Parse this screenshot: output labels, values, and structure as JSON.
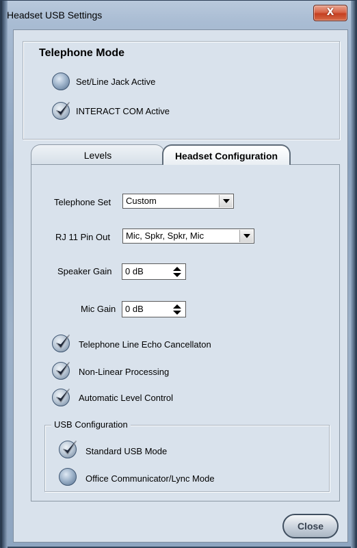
{
  "window": {
    "title": "Headset USB Settings",
    "close_glyph": "X"
  },
  "telephone_mode": {
    "title": "Telephone Mode",
    "options": [
      {
        "label": "Set/Line Jack Active",
        "selected": false
      },
      {
        "label": "INTERACT COM  Active",
        "selected": true
      }
    ]
  },
  "tabs": [
    {
      "label": "Levels",
      "active": false
    },
    {
      "label": "Headset Configuration",
      "active": true
    }
  ],
  "config": {
    "telephone_set": {
      "label": "Telephone Set",
      "value": "Custom"
    },
    "rj11_pin_out": {
      "label": "RJ 11 Pin Out",
      "value": "Mic, Spkr, Spkr, Mic"
    },
    "speaker_gain": {
      "label": "Speaker Gain",
      "value": "0 dB"
    },
    "mic_gain": {
      "label": "Mic Gain",
      "value": "0 dB"
    },
    "checks": [
      {
        "label": "Telephone Line Echo Cancellaton",
        "checked": true
      },
      {
        "label": "Non-Linear Processing",
        "checked": true
      },
      {
        "label": "Automatic Level Control",
        "checked": true
      }
    ]
  },
  "usb": {
    "title": "USB Configuration",
    "options": [
      {
        "label": "Standard USB Mode",
        "selected": true
      },
      {
        "label": "Office Communicator/Lync Mode",
        "selected": false
      }
    ]
  },
  "close_button": {
    "label": "Close"
  }
}
